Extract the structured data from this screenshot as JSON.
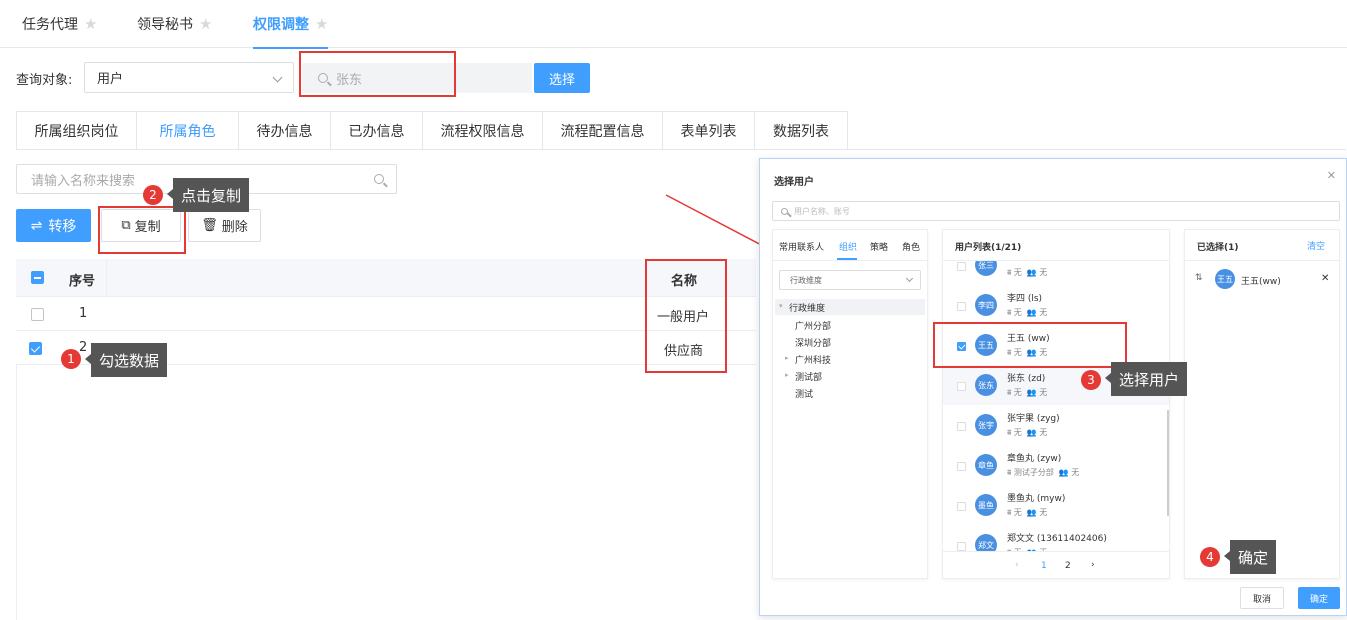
{
  "top_tabs": [
    {
      "label": "任务代理"
    },
    {
      "label": "领导秘书"
    },
    {
      "label": "权限调整"
    }
  ],
  "query": {
    "label": "查询对象:",
    "select_value": "用户",
    "search_value": "张东",
    "select_button": "选择"
  },
  "sub_tabs": [
    {
      "label": "所属组织岗位"
    },
    {
      "label": "所属角色"
    },
    {
      "label": "待办信息"
    },
    {
      "label": "已办信息"
    },
    {
      "label": "流程权限信息"
    },
    {
      "label": "流程配置信息"
    },
    {
      "label": "表单列表"
    },
    {
      "label": "数据列表"
    }
  ],
  "list": {
    "search_placeholder": "请输入名称来搜索",
    "transfer": "转移",
    "copy": "复制",
    "delete": "删除"
  },
  "table": {
    "col_index": "序号",
    "col_name": "名称",
    "rows": [
      {
        "index": "1",
        "name": "一般用户",
        "checked": false
      },
      {
        "index": "2",
        "name": "供应商",
        "checked": true
      }
    ]
  },
  "annotations": [
    {
      "num": "1",
      "text": "勾选数据"
    },
    {
      "num": "2",
      "text": "点击复制"
    },
    {
      "num": "3",
      "text": "选择用户"
    },
    {
      "num": "4",
      "text": "确定"
    }
  ],
  "dialog": {
    "title": "选择用户",
    "search_placeholder": "用户名称、账号",
    "left_tabs": [
      "常用联系人",
      "组织",
      "策略",
      "角色"
    ],
    "dimension": "行政维度",
    "tree": [
      "行政维度",
      "广州分部",
      "深圳分部",
      "广州科技",
      "测试部",
      "测试"
    ],
    "user_list_title": "用户列表(1/21)",
    "users": [
      {
        "avatar": "张三",
        "name": "",
        "meta1": "无",
        "meta2": "无",
        "checked": false
      },
      {
        "avatar": "李四",
        "name": "李四  (ls)",
        "meta1": "无",
        "meta2": "无",
        "checked": false
      },
      {
        "avatar": "王五",
        "name": "王五  (ww)",
        "meta1": "无",
        "meta2": "无",
        "checked": true
      },
      {
        "avatar": "张东",
        "name": "张东  (zd)",
        "meta1": "无",
        "meta2": "无",
        "checked": false
      },
      {
        "avatar": "张宇",
        "name": "张宇果  (zyg)",
        "meta1": "无",
        "meta2": "无",
        "checked": false
      },
      {
        "avatar": "章鱼",
        "name": "章鱼丸  (zyw)",
        "meta1": "测试子分部",
        "meta2": "无",
        "checked": false
      },
      {
        "avatar": "墨鱼",
        "name": "墨鱼丸  (myw)",
        "meta1": "无",
        "meta2": "无",
        "checked": false
      },
      {
        "avatar": "郑文",
        "name": "郑文文  (13611402406)",
        "meta1": "无",
        "meta2": "无",
        "checked": false
      }
    ],
    "pages": [
      "1",
      "2"
    ],
    "selected_title": "已选择(1)",
    "clear": "清空",
    "selected": [
      {
        "avatar": "王五",
        "name": "王五(ww)"
      }
    ],
    "cancel": "取消",
    "confirm": "确定"
  },
  "colors": {
    "accent": "#409eff",
    "annotation": "#e53935"
  }
}
